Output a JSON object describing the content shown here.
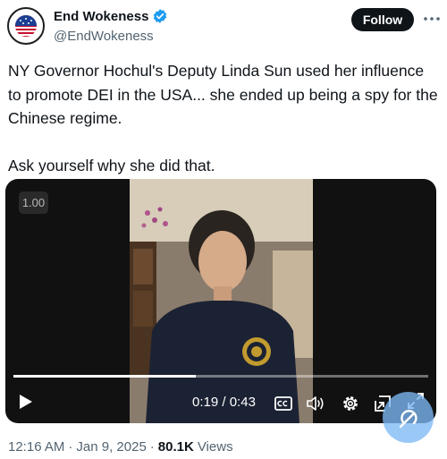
{
  "author": {
    "display_name": "End Wokeness",
    "handle": "@EndWokeness",
    "verified": true,
    "avatar_icon": "patriotic-seal-logo"
  },
  "header": {
    "follow_label": "Follow",
    "more_icon": "more-dots-icon"
  },
  "tweet": {
    "text": "NY Governor Hochul's Deputy Linda Sun used her influence to promote DEI in the USA... she ended up being a spy for the Chinese regime.\n\nAsk yourself why she did that."
  },
  "video": {
    "speed": "1.00",
    "current_time": "0:19",
    "time_separator": "/",
    "duration": "0:43",
    "progress_percent": 44,
    "controls": [
      "play-icon",
      "closed-captions-icon",
      "volume-icon",
      "settings-icon",
      "pip-icon",
      "fullscreen-icon"
    ]
  },
  "meta": {
    "time": "12:16 AM",
    "separator": "·",
    "date": "Jan 9, 2025",
    "views_count": "80.1K",
    "views_label": "Views"
  },
  "colors": {
    "verified": "#1d9bf0",
    "text": "#0f1419",
    "secondary": "#536471",
    "follow_bg": "#0f1419",
    "player_bg": "#111111",
    "fab": "#7db9f5"
  }
}
